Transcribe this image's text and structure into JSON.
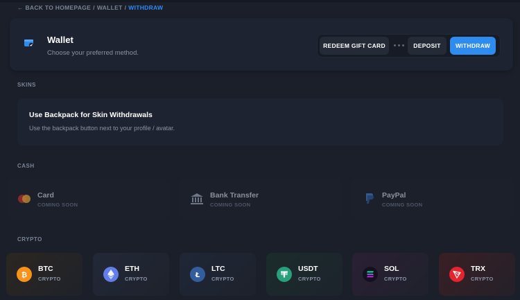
{
  "breadcrumb": {
    "back": "← BACK TO HOMEPAGE",
    "wallet": "WALLET",
    "current": "WITHDRAW",
    "separator": "/"
  },
  "wallet": {
    "icon": "wallet-icon",
    "title": "Wallet",
    "subtitle": "Choose your preferred method.",
    "actions": {
      "gift_card": "REDEEM GIFT CARD",
      "deposit": "DEPOSIT",
      "withdraw": "WITHDRAW"
    }
  },
  "sections": {
    "skins": "SKINS",
    "cash": "CASH",
    "crypto": "CRYPTO"
  },
  "skins": {
    "title": "Use Backpack for Skin Withdrawals",
    "subtitle": "Use the backpack button next to your profile / avatar."
  },
  "cash_methods": [
    {
      "name": "Card",
      "status": "COMING SOON",
      "icon": "card-icon"
    },
    {
      "name": "Bank Transfer",
      "status": "COMING SOON",
      "icon": "bank-icon"
    },
    {
      "name": "PayPal",
      "status": "COMING SOON",
      "icon": "paypal-icon"
    }
  ],
  "crypto_methods": [
    {
      "name": "BTC",
      "type": "CRYPTO",
      "icon": "bitcoin-icon",
      "color": "#f7931a"
    },
    {
      "name": "ETH",
      "type": "CRYPTO",
      "icon": "ethereum-icon",
      "color": "#627eea"
    },
    {
      "name": "LTC",
      "type": "CRYPTO",
      "icon": "litecoin-icon",
      "color": "#345d9d"
    },
    {
      "name": "USDT",
      "type": "CRYPTO",
      "icon": "tether-icon",
      "color": "#26a17b"
    },
    {
      "name": "SOL",
      "type": "CRYPTO",
      "icon": "solana-icon",
      "color": "#14111f"
    },
    {
      "name": "TRX",
      "type": "CRYPTO",
      "icon": "tron-icon",
      "color": "#e5242d"
    }
  ],
  "colors": {
    "accent": "#2e8bef",
    "background": "#1a1f2a",
    "card": "#1d2330"
  }
}
